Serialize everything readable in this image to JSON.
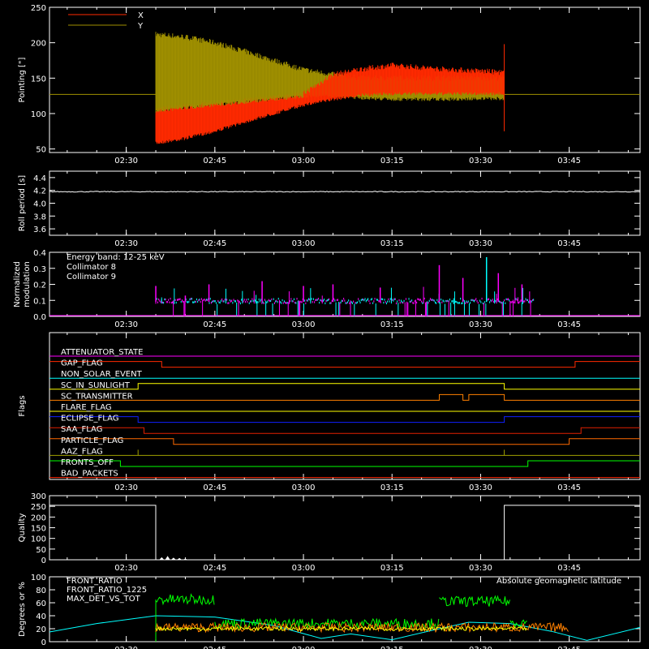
{
  "colors": {
    "background": "#000000",
    "axes": "#ffffff",
    "red": "#ff2a00",
    "olive": "#a09000",
    "cyan": "#00ffff",
    "magenta": "#ff00ff",
    "green": "#00ff00",
    "orange": "#ff8000",
    "yellow": "#ffff00",
    "blue": "#1020ff",
    "dark_orange": "#ff6a00",
    "dark_red": "#e02000",
    "olive_green": "#a0a000"
  },
  "time_ticks": [
    "02:30",
    "02:45",
    "03:00",
    "03:15",
    "03:30",
    "03:45"
  ],
  "chart_data": [
    {
      "id": "pointing",
      "type": "area",
      "ylabel": "Pointing [\"]",
      "ylim": [
        45,
        250
      ],
      "yticks": [
        50,
        100,
        150,
        200,
        250
      ],
      "legend": [
        {
          "name": "X",
          "color": "#ff2a00"
        },
        {
          "name": "Y",
          "color": "#a09000"
        }
      ],
      "legend_position": "top-left",
      "xlim": [
        "02:17",
        "03:57"
      ],
      "baseline": 127,
      "series": [
        {
          "name": "Y",
          "x": [
            "02:35",
            "02:40",
            "02:45",
            "02:50",
            "02:55",
            "03:00",
            "03:05",
            "03:10",
            "03:15",
            "03:20",
            "03:25",
            "03:30",
            "03:34"
          ],
          "upper": [
            212,
            208,
            200,
            188,
            175,
            162,
            155,
            150,
            150,
            150,
            150,
            150,
            150
          ],
          "lower": [
            103,
            108,
            112,
            116,
            120,
            124,
            125,
            122,
            120,
            120,
            120,
            121,
            121
          ]
        },
        {
          "name": "X",
          "x": [
            "02:35",
            "02:40",
            "02:45",
            "02:50",
            "02:55",
            "03:00",
            "03:05",
            "03:10",
            "03:15",
            "03:20",
            "03:25",
            "03:30",
            "03:34"
          ],
          "upper": [
            105,
            110,
            114,
            118,
            122,
            128,
            155,
            163,
            168,
            165,
            162,
            160,
            158
          ],
          "lower": [
            58,
            65,
            75,
            88,
            100,
            112,
            120,
            126,
            128,
            128,
            128,
            128,
            128
          ]
        }
      ]
    },
    {
      "id": "roll",
      "type": "line",
      "ylabel": "Roll period [s]",
      "ylim": [
        3.5,
        4.5
      ],
      "yticks": [
        "3.6",
        "3.8",
        "4.0",
        "4.2",
        "4.4"
      ],
      "xlim": [
        "02:17",
        "03:57"
      ],
      "series": [
        {
          "name": "Roll period",
          "value": 4.18
        }
      ]
    },
    {
      "id": "modulation",
      "type": "bar",
      "ylabel": "Normalized modulation",
      "ylim": [
        0,
        0.4
      ],
      "yticks": [
        "0.0",
        "0.1",
        "0.2",
        "0.3",
        "0.4"
      ],
      "xlim": [
        "02:17",
        "03:57"
      ],
      "annotation": "Energy band: 12-25 keV",
      "legend": [
        {
          "name": "Collimator 8",
          "color": "#00ffff"
        },
        {
          "name": "Collimator 9",
          "color": "#ff00ff"
        }
      ],
      "time_range": [
        "02:35",
        "03:39"
      ],
      "typical": 0.09,
      "spikes": [
        {
          "t": "02:35",
          "v": 0.19,
          "s": "Collimator 9"
        },
        {
          "t": "02:40",
          "v": 0.13,
          "s": "Collimator 9"
        },
        {
          "t": "02:44",
          "v": 0.2,
          "s": "Collimator 9"
        },
        {
          "t": "02:53",
          "v": 0.22,
          "s": "Collimator 9"
        },
        {
          "t": "03:00",
          "v": 0.19,
          "s": "Collimator 9"
        },
        {
          "t": "03:05",
          "v": 0.2,
          "s": "Collimator 9"
        },
        {
          "t": "03:13",
          "v": 0.18,
          "s": "Collimator 9"
        },
        {
          "t": "03:23",
          "v": 0.32,
          "s": "Collimator 9"
        },
        {
          "t": "03:27",
          "v": 0.24,
          "s": "Collimator 9"
        },
        {
          "t": "03:31",
          "v": 0.37,
          "s": "Collimator 8"
        },
        {
          "t": "03:33",
          "v": 0.27,
          "s": "Collimator 9"
        },
        {
          "t": "03:37",
          "v": 0.2,
          "s": "Collimator 9"
        }
      ]
    },
    {
      "id": "flags",
      "type": "line",
      "ylabel": "Flags",
      "xlim": [
        "02:17",
        "03:57"
      ],
      "flags": [
        {
          "name": "ATTENUATOR_STATE",
          "color": "#ff00ff",
          "steps": [
            [
              "02:17",
              0
            ]
          ]
        },
        {
          "name": "GAP_FLAG",
          "color": "#ff2a00",
          "steps": [
            [
              "02:17",
              1
            ],
            [
              "02:36",
              0
            ],
            [
              "03:46",
              1
            ]
          ]
        },
        {
          "name": "NON_SOLAR_EVENT",
          "color": "#00ffff",
          "steps": [
            [
              "02:17",
              0
            ]
          ]
        },
        {
          "name": "SC_IN_SUNLIGHT",
          "color": "#ffff00",
          "steps": [
            [
              "02:17",
              0
            ],
            [
              "02:32",
              1
            ],
            [
              "03:34",
              0
            ]
          ]
        },
        {
          "name": "SC_TRANSMITTER",
          "color": "#ff8000",
          "steps": [
            [
              "02:17",
              0
            ],
            [
              "03:23",
              1
            ],
            [
              "03:27",
              0
            ],
            [
              "03:28",
              1
            ],
            [
              "03:34",
              0
            ]
          ]
        },
        {
          "name": "FLARE_FLAG",
          "color": "#ffff00",
          "steps": [
            [
              "02:17",
              0
            ]
          ]
        },
        {
          "name": "ECLIPSE_FLAG",
          "color": "#1020ff",
          "steps": [
            [
              "02:17",
              1
            ],
            [
              "02:32",
              0
            ],
            [
              "03:34",
              1
            ]
          ]
        },
        {
          "name": "SAA_FLAG",
          "color": "#e02000",
          "steps": [
            [
              "02:17",
              1
            ],
            [
              "02:33",
              0
            ],
            [
              "03:47",
              1
            ]
          ]
        },
        {
          "name": "PARTICLE_FLAG",
          "color": "#ff6a00",
          "steps": [
            [
              "02:17",
              1
            ],
            [
              "02:38",
              0
            ],
            [
              "03:45",
              1
            ]
          ]
        },
        {
          "name": "AAZ_FLAG",
          "color": "#a0a000",
          "steps": [
            [
              "02:17",
              0
            ],
            [
              "02:32",
              1
            ],
            [
              "02:32",
              0
            ],
            [
              "03:34",
              1
            ],
            [
              "03:34",
              0
            ]
          ]
        },
        {
          "name": "FRONTS_OFF",
          "color": "#00ff00",
          "steps": [
            [
              "02:17",
              1
            ],
            [
              "02:29",
              0
            ],
            [
              "03:38",
              1
            ]
          ]
        },
        {
          "name": "BAD_PACKETS",
          "color": "#ff2a00",
          "steps": [
            [
              "02:17",
              0
            ]
          ]
        }
      ]
    },
    {
      "id": "quality",
      "type": "line",
      "ylabel": "Quality",
      "ylim": [
        0,
        300
      ],
      "yticks": [
        "0",
        "50",
        "100",
        "150",
        "200",
        "250",
        "300"
      ],
      "xlim": [
        "02:17",
        "03:57"
      ],
      "x": [
        "02:17",
        "02:35",
        "02:35",
        "03:34",
        "03:34",
        "03:57"
      ],
      "y": [
        255,
        255,
        0,
        0,
        255,
        255
      ],
      "blips": [
        {
          "t": "02:36",
          "v": 12
        },
        {
          "t": "02:37",
          "v": 18
        },
        {
          "t": "02:38",
          "v": 10
        },
        {
          "t": "02:39",
          "v": 8
        },
        {
          "t": "02:40",
          "v": 5
        }
      ]
    },
    {
      "id": "ratios",
      "type": "line",
      "ylabel": "Degrees or %",
      "ylim": [
        0,
        100
      ],
      "yticks": [
        "0",
        "20",
        "40",
        "60",
        "80",
        "100"
      ],
      "xlim": [
        "02:17",
        "03:57"
      ],
      "legend": [
        {
          "name": "FRONT_RATIO",
          "color": "#ffff00"
        },
        {
          "name": "FRONT_RATIO_1225",
          "color": "#00ff00"
        },
        {
          "name": "MAX_DET_VS_TOT",
          "color": "#ff8000"
        }
      ],
      "annotation": "Absolute geomagnetic latitude",
      "annotation_color": "#00ffff",
      "series": [
        {
          "name": "Absolute geomagnetic latitude",
          "x": [
            "02:17",
            "02:25",
            "02:35",
            "02:45",
            "02:55",
            "03:03",
            "03:08",
            "03:15",
            "03:22",
            "03:28",
            "03:35",
            "03:42",
            "03:48",
            "03:57"
          ],
          "y": [
            15,
            28,
            40,
            38,
            25,
            5,
            12,
            3,
            18,
            30,
            28,
            16,
            2,
            22
          ]
        },
        {
          "name": "FRONT_RATIO_1225",
          "segments": [
            {
              "x": [
                "02:35",
                "02:45"
              ],
              "level": 65
            },
            {
              "x": [
                "02:45",
                "03:23"
              ],
              "level": 28
            },
            {
              "x": [
                "03:23",
                "03:35"
              ],
              "level": 62
            },
            {
              "x": [
                "03:35",
                "03:38"
              ],
              "level": 30
            }
          ]
        },
        {
          "name": "FRONT_RATIO",
          "x": [
            "02:35",
            "03:38"
          ],
          "level": 20
        },
        {
          "name": "MAX_DET_VS_TOT",
          "x": [
            "02:35",
            "03:45"
          ],
          "level": 22
        }
      ]
    }
  ]
}
